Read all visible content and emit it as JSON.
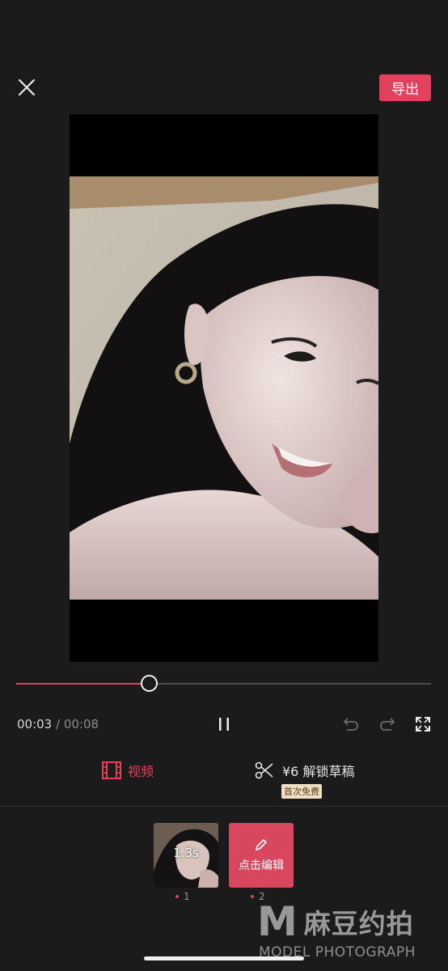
{
  "header": {
    "close_icon": "close-icon",
    "export_label": "导出",
    "accent_color": "#e2405c"
  },
  "player": {
    "progress": 0.32,
    "current_time": "00:03",
    "separator": "/",
    "total_time": "00:08",
    "controls": [
      "pause-icon",
      "undo-icon",
      "redo-icon",
      "fullscreen-icon"
    ]
  },
  "tabs": {
    "video_label": "视频",
    "unlock_label": "¥6 解锁草稿",
    "free_badge": "首次免费"
  },
  "clips": [
    {
      "duration": "1.3s",
      "number": "1"
    },
    {
      "edit_label": "点击编辑",
      "number": "2"
    }
  ],
  "watermark": {
    "letter": "M",
    "chinese": "麻豆约拍",
    "english": "MODEL PHOTOGRAPH"
  }
}
